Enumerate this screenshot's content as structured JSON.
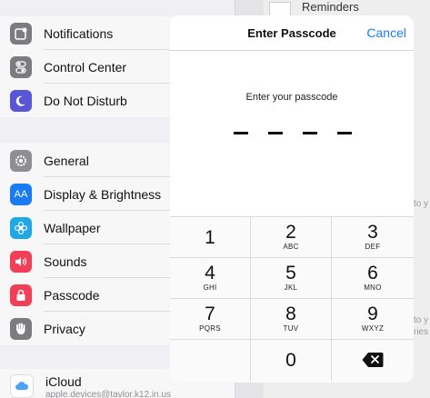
{
  "background": {
    "reminders_label": "Reminders",
    "peek_texts": [
      "to y",
      "to y",
      "ries"
    ]
  },
  "sidebar": {
    "group1": [
      {
        "label": "Notifications",
        "icon": "notifications-icon",
        "color": "#7b7b80"
      },
      {
        "label": "Control Center",
        "icon": "control-center-icon",
        "color": "#7b7b80"
      },
      {
        "label": "Do Not Disturb",
        "icon": "moon-icon",
        "color": "#5856d6"
      }
    ],
    "group2": [
      {
        "label": "General",
        "icon": "gear-icon",
        "color": "#8e8e93"
      },
      {
        "label": "Display & Brightness",
        "icon": "display-brightness-icon",
        "color": "#1a7cf5",
        "glyph": "AA"
      },
      {
        "label": "Wallpaper",
        "icon": "wallpaper-icon",
        "color": "#1fa8e8"
      },
      {
        "label": "Sounds",
        "icon": "sounds-icon",
        "color": "#f23f57"
      },
      {
        "label": "Passcode",
        "icon": "lock-icon",
        "color": "#f23f57"
      },
      {
        "label": "Privacy",
        "icon": "hand-icon",
        "color": "#7b7b80"
      }
    ],
    "icloud": {
      "label": "iCloud",
      "sublabel": "apple.devices@taylor.k12.in.us",
      "color": "#4aa4f5"
    }
  },
  "dialog": {
    "title": "Enter Passcode",
    "cancel_label": "Cancel",
    "prompt": "Enter your passcode",
    "digits_entered": 0,
    "digits_total": 4
  },
  "keypad": {
    "keys": [
      {
        "num": "1",
        "letters": ""
      },
      {
        "num": "2",
        "letters": "ABC"
      },
      {
        "num": "3",
        "letters": "DEF"
      },
      {
        "num": "4",
        "letters": "GHI"
      },
      {
        "num": "5",
        "letters": "JKL"
      },
      {
        "num": "6",
        "letters": "MNO"
      },
      {
        "num": "7",
        "letters": "PQRS"
      },
      {
        "num": "8",
        "letters": "TUV"
      },
      {
        "num": "9",
        "letters": "WXYZ"
      },
      {
        "num": "0",
        "letters": ""
      }
    ],
    "delete_icon": "delete-backspace-icon"
  }
}
